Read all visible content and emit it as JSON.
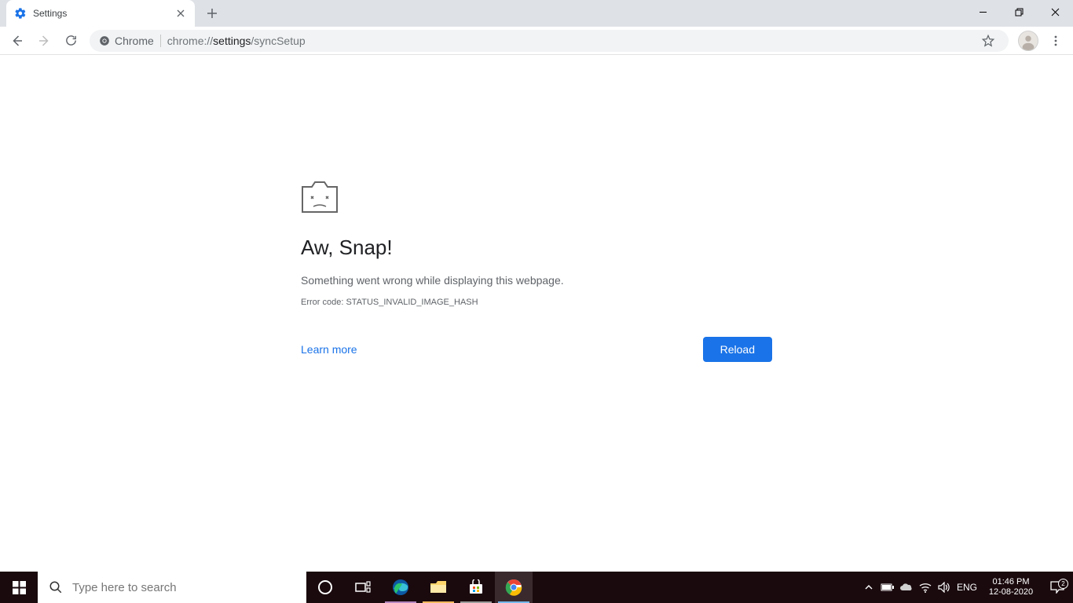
{
  "browser": {
    "tab_title": "Settings",
    "omnibox_chip": "Chrome",
    "url_prefix": "chrome://",
    "url_bold": "settings",
    "url_suffix": "/syncSetup"
  },
  "error": {
    "title": "Aw, Snap!",
    "description": "Something went wrong while displaying this webpage.",
    "code_label": "Error code: STATUS_INVALID_IMAGE_HASH",
    "learn_more": "Learn more",
    "reload": "Reload"
  },
  "taskbar": {
    "search_placeholder": "Type here to search",
    "lang": "ENG",
    "time": "01:46 PM",
    "date": "12-08-2020",
    "notif_count": "2"
  }
}
